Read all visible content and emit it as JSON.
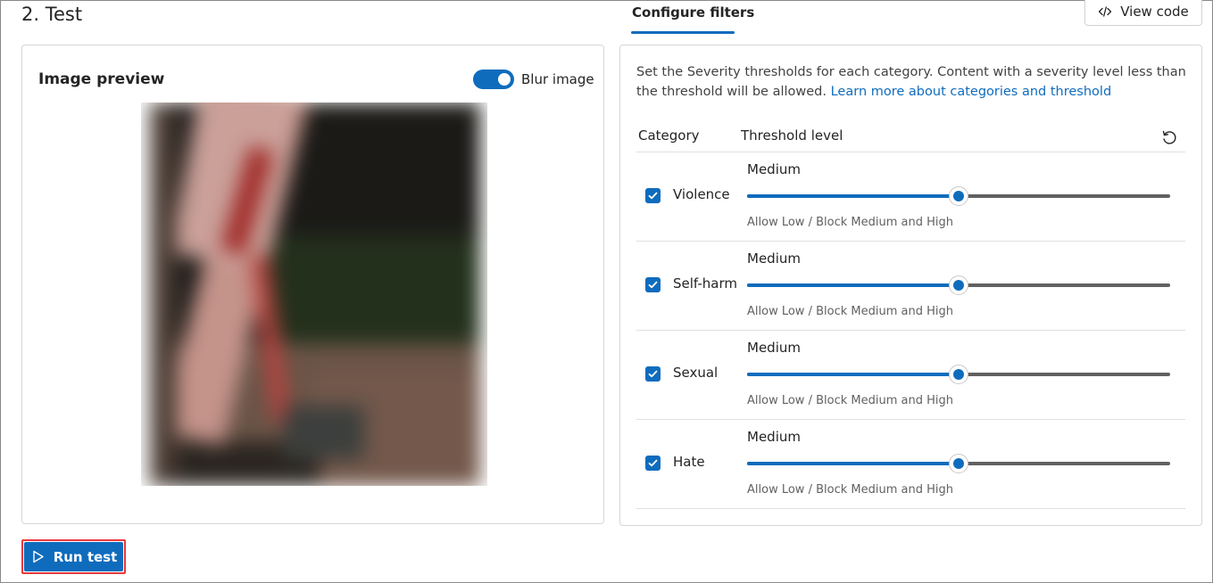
{
  "section": {
    "title": "2. Test"
  },
  "tabs": [
    {
      "label": "Configure filters",
      "active": true
    }
  ],
  "view_code": {
    "label": "View code",
    "icon": "code-icon"
  },
  "preview": {
    "title": "Image preview",
    "blur_toggle": {
      "label": "Blur image",
      "on": true
    }
  },
  "filters": {
    "description": "Set the Severity thresholds for each category. Content with a severity level less than the threshold will be allowed.",
    "learn_more": "Learn more about categories and threshold",
    "headers": {
      "category": "Category",
      "threshold": "Threshold level"
    },
    "reset_icon": "reset-icon",
    "rows": [
      {
        "category": "Violence",
        "checked": true,
        "level": "Medium",
        "slider_fraction": 0.5,
        "hint": "Allow Low / Block Medium and High"
      },
      {
        "category": "Self-harm",
        "checked": true,
        "level": "Medium",
        "slider_fraction": 0.5,
        "hint": "Allow Low / Block Medium and High"
      },
      {
        "category": "Sexual",
        "checked": true,
        "level": "Medium",
        "slider_fraction": 0.5,
        "hint": "Allow Low / Block Medium and High"
      },
      {
        "category": "Hate",
        "checked": true,
        "level": "Medium",
        "slider_fraction": 0.5,
        "hint": "Allow Low / Block Medium and High"
      }
    ]
  },
  "run_test": {
    "label": "Run test",
    "icon": "play-icon"
  },
  "colors": {
    "accent": "#0f6cbd",
    "highlight_border": "#e8383d"
  }
}
